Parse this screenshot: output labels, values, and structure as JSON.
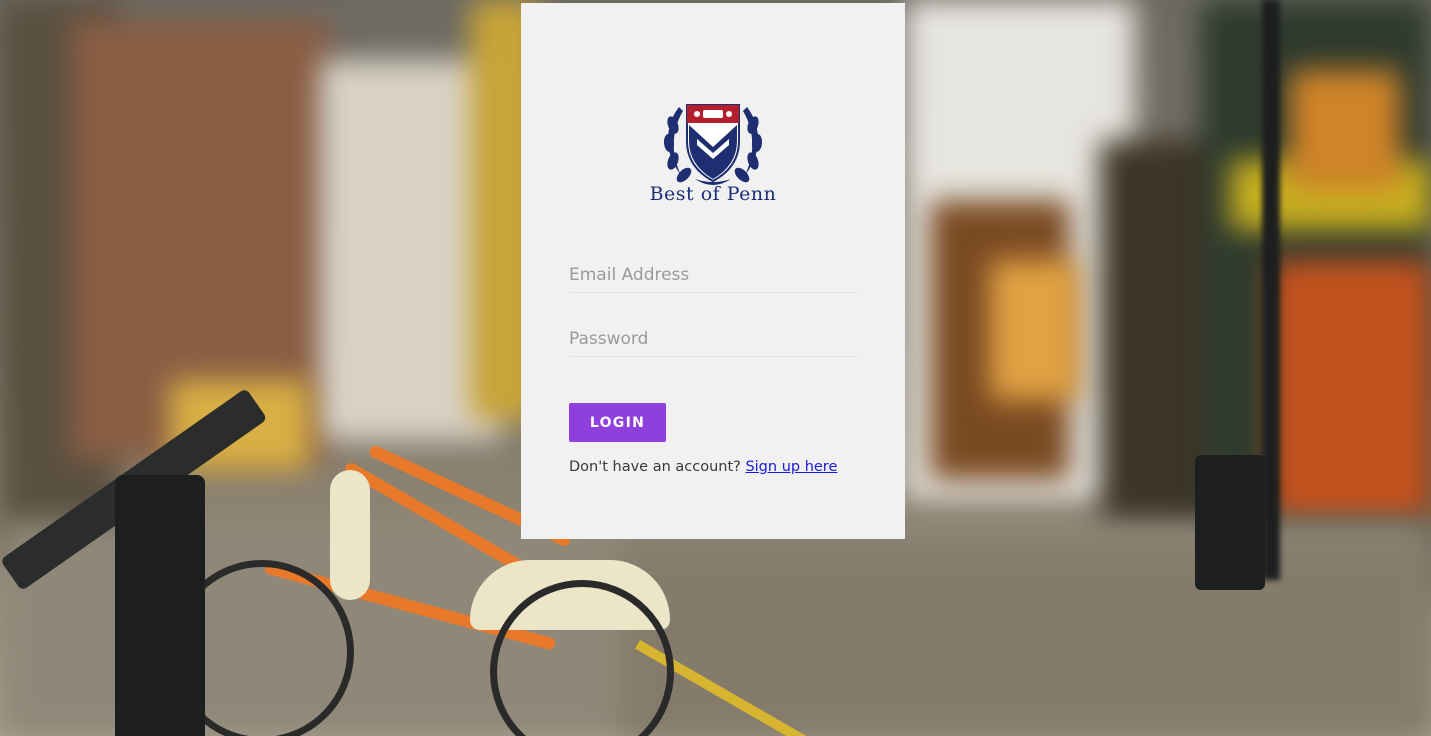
{
  "brand": {
    "logo_text": "Best of Penn",
    "logo_icon": "penn-shield-laurel-icon",
    "colors": {
      "logo_blue": "#1c2d78",
      "shield_red": "#b41f2d",
      "laurel_navy": "#1e2e70"
    }
  },
  "login_form": {
    "email_placeholder": "Email Address",
    "password_placeholder": "Password",
    "email_value": "",
    "password_value": "",
    "submit_label": "LOGIN",
    "signup_prompt": "Don't have an account?",
    "signup_link": "Sign up here",
    "colors": {
      "button_bg": "#8e3fdc",
      "card_bg": "#f1f1f2",
      "link": "#1a1adb"
    }
  },
  "background": {
    "icon": "city-street-bikes-photo"
  }
}
